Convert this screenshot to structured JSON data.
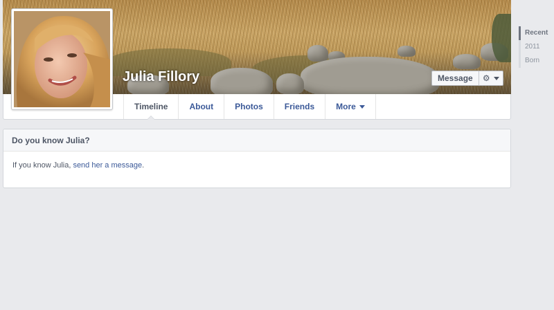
{
  "profile": {
    "name": "Julia Fillory",
    "first_name": "Julia"
  },
  "cover_actions": {
    "message_label": "Message",
    "gear_icon": "gear-icon"
  },
  "nav": {
    "tabs": [
      {
        "label": "Timeline",
        "active": true
      },
      {
        "label": "About"
      },
      {
        "label": "Photos"
      },
      {
        "label": "Friends"
      },
      {
        "label": "More",
        "has_caret": true
      }
    ]
  },
  "know_panel": {
    "title": "Do you know Julia?",
    "text_prefix": "If you know Julia, ",
    "link_text": "send her a message",
    "text_suffix": "."
  },
  "scrubber": {
    "items": [
      {
        "label": "Recent",
        "active": true
      },
      {
        "label": "2011"
      },
      {
        "label": "Born"
      }
    ]
  },
  "colors": {
    "background": "#e9eaed",
    "link": "#3b5998",
    "text": "#4e5665"
  }
}
